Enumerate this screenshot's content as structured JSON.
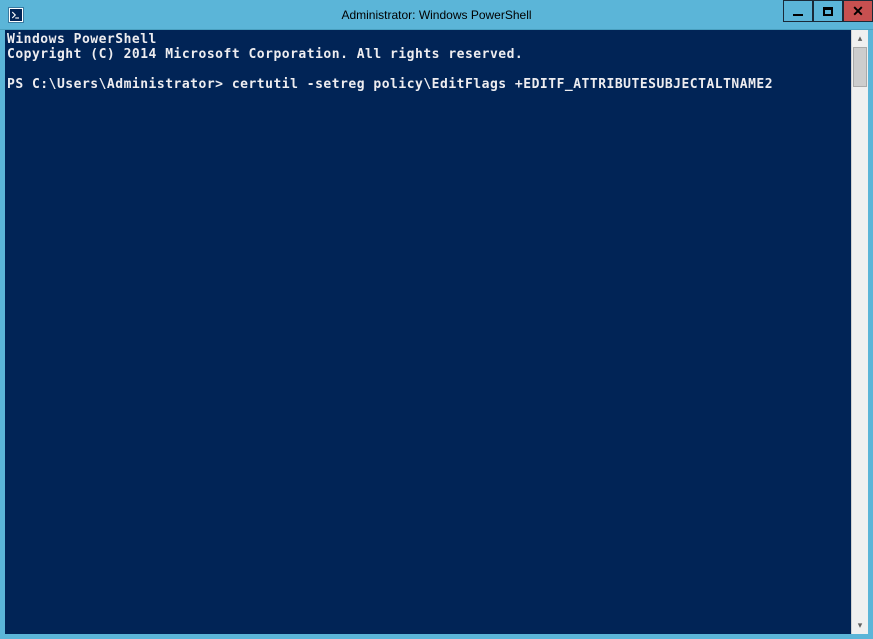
{
  "titlebar": {
    "title": "Administrator: Windows PowerShell"
  },
  "console": {
    "header1": "Windows PowerShell",
    "header2": "Copyright (C) 2014 Microsoft Corporation. All rights reserved.",
    "prompt": "PS C:\\Users\\Administrator>",
    "command": "certutil -setreg policy\\EditFlags +EDITF_ATTRIBUTESUBJECTALTNAME2"
  },
  "colors": {
    "titlebar_bg": "#5bb5d8",
    "console_bg": "#012456",
    "console_fg": "#eeedf0",
    "close_bg": "#c75050"
  }
}
